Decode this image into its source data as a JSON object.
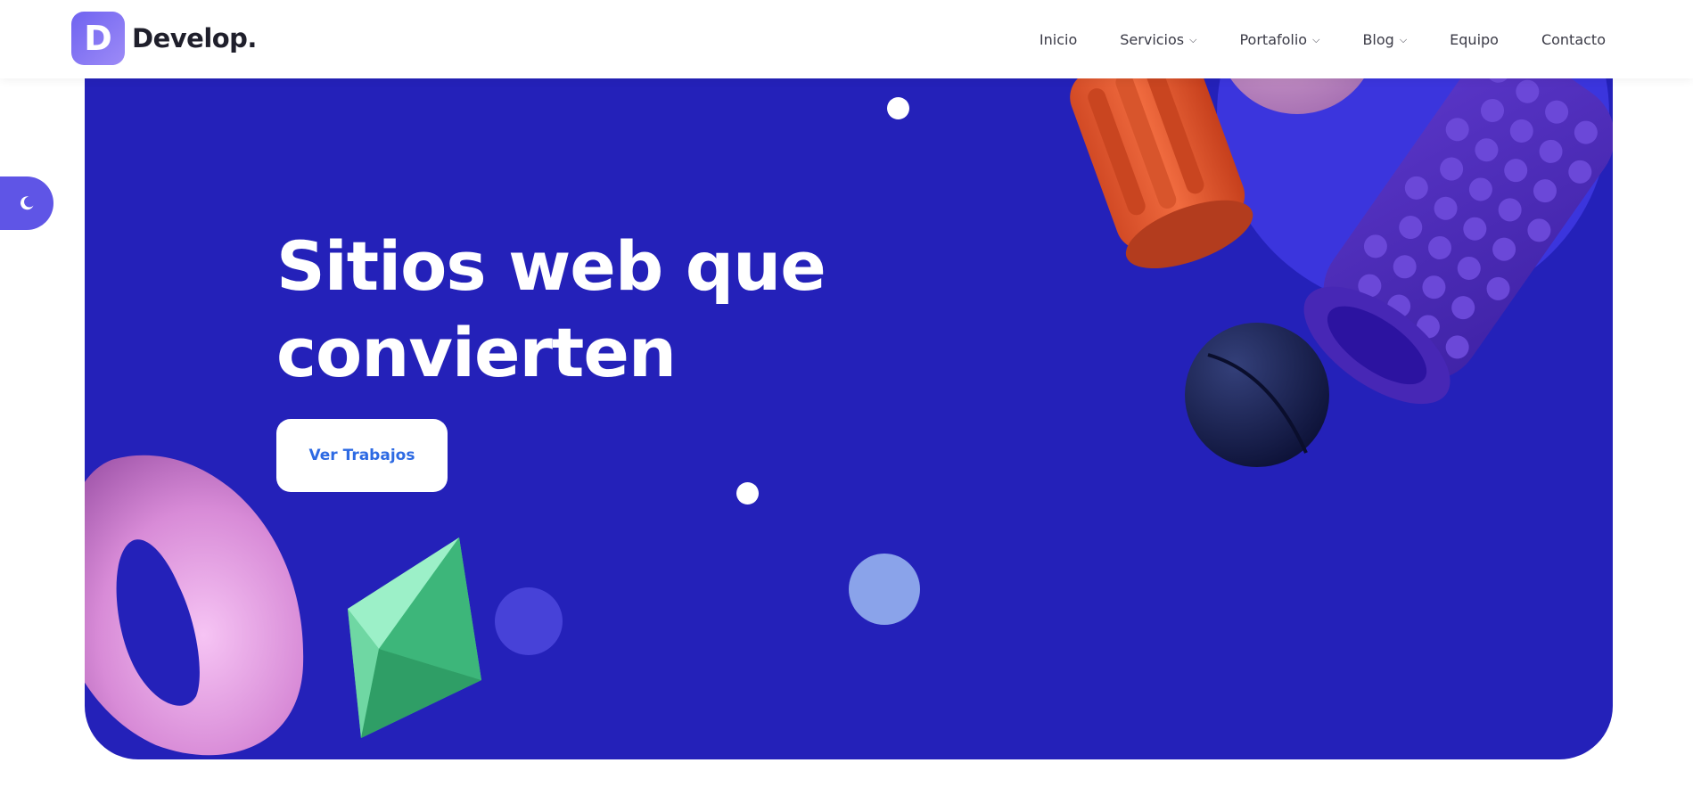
{
  "brand": {
    "logo_letter": "D",
    "name": "Develop."
  },
  "nav": {
    "items": [
      {
        "label": "Inicio",
        "dropdown": false
      },
      {
        "label": "Servicios",
        "dropdown": true
      },
      {
        "label": "Portafolio",
        "dropdown": true
      },
      {
        "label": "Blog",
        "dropdown": true
      },
      {
        "label": "Equipo",
        "dropdown": false
      },
      {
        "label": "Contacto",
        "dropdown": false
      }
    ],
    "dropdown_icon": "chevron-down-icon"
  },
  "theme_toggle": {
    "icon": "moon-icon"
  },
  "hero": {
    "title_line1": "Sitios web que",
    "title_line2": "convierten",
    "cta_label": "Ver Trabajos"
  },
  "colors": {
    "hero_background": "#2421b9",
    "accent_purple": "#5f55e6",
    "cta_text": "#2d6ae3",
    "nav_text": "#3a3a46"
  }
}
